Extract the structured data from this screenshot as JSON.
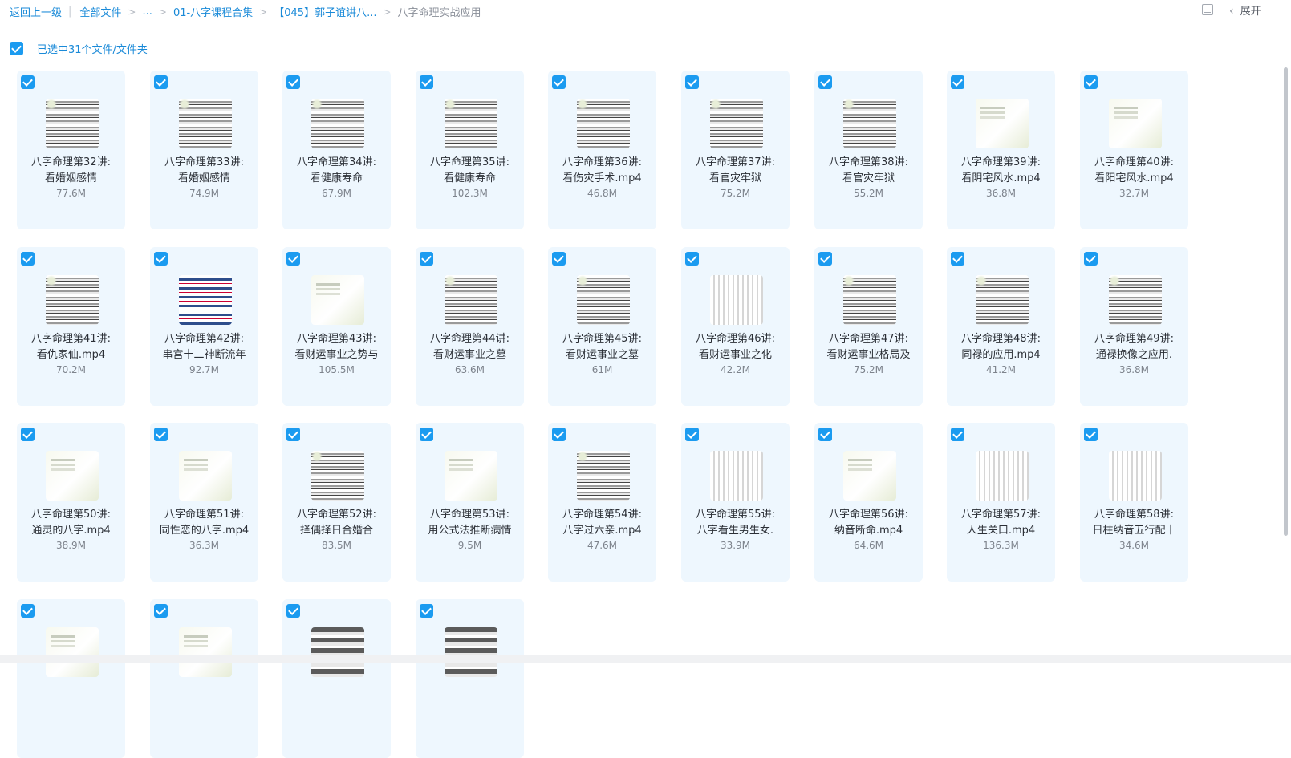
{
  "breadcrumb": {
    "back": "返回上一级",
    "items": [
      "全部文件",
      "...",
      "01-八字课程合集",
      "【045】郭子谊讲八...",
      "八字命理实战应用"
    ]
  },
  "toolbar": {
    "expand": "展开",
    "list_view_icon": "list-view-icon",
    "chevron_icon": "chevron-left-icon"
  },
  "selection": {
    "text": "已选中31个文件/文件夹",
    "all_checked": true
  },
  "colors": {
    "accent": "#1b9bf0",
    "card_bg": "#eef7fe",
    "link": "#1a8ad8"
  },
  "files": [
    {
      "line1": "八字命理第32讲:",
      "line2": "看婚姻感情",
      "size": "77.6M",
      "thumb": "a"
    },
    {
      "line1": "八字命理第33讲:",
      "line2": "看婚姻感情",
      "size": "74.9M",
      "thumb": "a"
    },
    {
      "line1": "八字命理第34讲:",
      "line2": "看健康寿命",
      "size": "67.9M",
      "thumb": "a"
    },
    {
      "line1": "八字命理第35讲:",
      "line2": "看健康寿命",
      "size": "102.3M",
      "thumb": "a"
    },
    {
      "line1": "八字命理第36讲:",
      "line2": "看伤灾手术.mp4",
      "size": "46.8M",
      "thumb": "a"
    },
    {
      "line1": "八字命理第37讲:",
      "line2": "看官灾牢狱",
      "size": "75.2M",
      "thumb": "a"
    },
    {
      "line1": "八字命理第38讲:",
      "line2": "看官灾牢狱",
      "size": "55.2M",
      "thumb": "a"
    },
    {
      "line1": "八字命理第39讲:",
      "line2": "看阴宅风水.mp4",
      "size": "36.8M",
      "thumb": "b"
    },
    {
      "line1": "八字命理第40讲:",
      "line2": "看阳宅风水.mp4",
      "size": "32.7M",
      "thumb": "b"
    },
    {
      "line1": "八字命理第41讲:",
      "line2": "看仇家仙.mp4",
      "size": "70.2M",
      "thumb": "a"
    },
    {
      "line1": "八字命理第42讲:",
      "line2": "串宫十二神断流年",
      "size": "92.7M",
      "thumb": "d"
    },
    {
      "line1": "八字命理第43讲:",
      "line2": "看财运事业之势与",
      "size": "105.5M",
      "thumb": "b"
    },
    {
      "line1": "八字命理第44讲:",
      "line2": "看财运事业之墓",
      "size": "63.6M",
      "thumb": "a"
    },
    {
      "line1": "八字命理第45讲:",
      "line2": "看财运事业之墓",
      "size": "61M",
      "thumb": "a"
    },
    {
      "line1": "八字命理第46讲:",
      "line2": "看财运事业之化",
      "size": "42.2M",
      "thumb": "c"
    },
    {
      "line1": "八字命理第47讲:",
      "line2": "看财运事业格局及",
      "size": "75.2M",
      "thumb": "a"
    },
    {
      "line1": "八字命理第48讲:",
      "line2": "同禄的应用.mp4",
      "size": "41.2M",
      "thumb": "a"
    },
    {
      "line1": "八字命理第49讲:",
      "line2": "通禄换像之应用.",
      "size": "36.8M",
      "thumb": "a"
    },
    {
      "line1": "八字命理第50讲:",
      "line2": "通灵的八字.mp4",
      "size": "38.9M",
      "thumb": "b"
    },
    {
      "line1": "八字命理第51讲:",
      "line2": "同性恋的八字.mp4",
      "size": "36.3M",
      "thumb": "b"
    },
    {
      "line1": "八字命理第52讲:",
      "line2": "择偶择日合婚合",
      "size": "83.5M",
      "thumb": "a"
    },
    {
      "line1": "八字命理第53讲:",
      "line2": "用公式法推断病情",
      "size": "9.5M",
      "thumb": "b"
    },
    {
      "line1": "八字命理第54讲:",
      "line2": "八字过六亲.mp4",
      "size": "47.6M",
      "thumb": "a"
    },
    {
      "line1": "八字命理第55讲:",
      "line2": "八字看生男生女.",
      "size": "33.9M",
      "thumb": "c"
    },
    {
      "line1": "八字命理第56讲:",
      "line2": "纳音断命.mp4",
      "size": "64.6M",
      "thumb": "b"
    },
    {
      "line1": "八字命理第57讲:",
      "line2": "人生关口.mp4",
      "size": "136.3M",
      "thumb": "c"
    },
    {
      "line1": "八字命理第58讲:",
      "line2": "日柱纳音五行配十",
      "size": "34.6M",
      "thumb": "c"
    },
    {
      "line1": "",
      "line2": "",
      "size": "",
      "thumb": "b"
    },
    {
      "line1": "",
      "line2": "",
      "size": "",
      "thumb": "b"
    },
    {
      "line1": "",
      "line2": "",
      "size": "",
      "thumb": "e"
    },
    {
      "line1": "",
      "line2": "",
      "size": "",
      "thumb": "e"
    }
  ]
}
